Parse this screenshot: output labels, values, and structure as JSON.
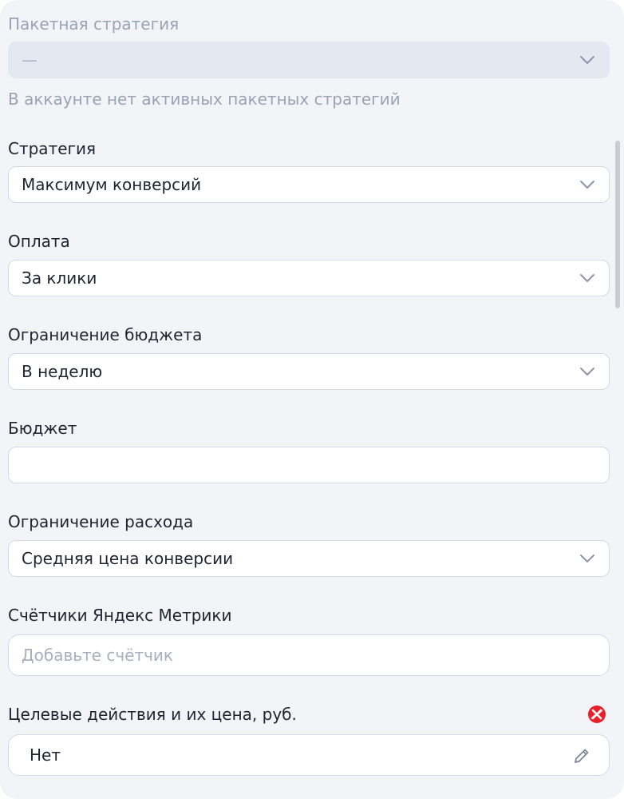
{
  "package_strategy": {
    "label": "Пакетная стратегия",
    "value": "—",
    "hint": "В аккаунте нет активных пакетных стратегий"
  },
  "strategy": {
    "label": "Стратегия",
    "value": "Максимум конверсий"
  },
  "payment": {
    "label": "Оплата",
    "value": "За клики"
  },
  "budget_limit": {
    "label": "Ограничение бюджета",
    "value": "В неделю"
  },
  "budget": {
    "label": "Бюджет",
    "value": ""
  },
  "spend_limit": {
    "label": "Ограничение расхода",
    "value": "Средняя цена конверсии"
  },
  "metrica_counters": {
    "label": "Счётчики Яндекс Метрики",
    "placeholder": "Добавьте счётчик"
  },
  "goals": {
    "label": "Целевые действия и их цена, руб.",
    "value": "Нет"
  },
  "colors": {
    "error": "#e8202a",
    "panel_bg": "#f2f4f8",
    "border": "#d4d9e3"
  },
  "icons": [
    "chevron-down-icon",
    "error-icon",
    "pencil-icon"
  ]
}
